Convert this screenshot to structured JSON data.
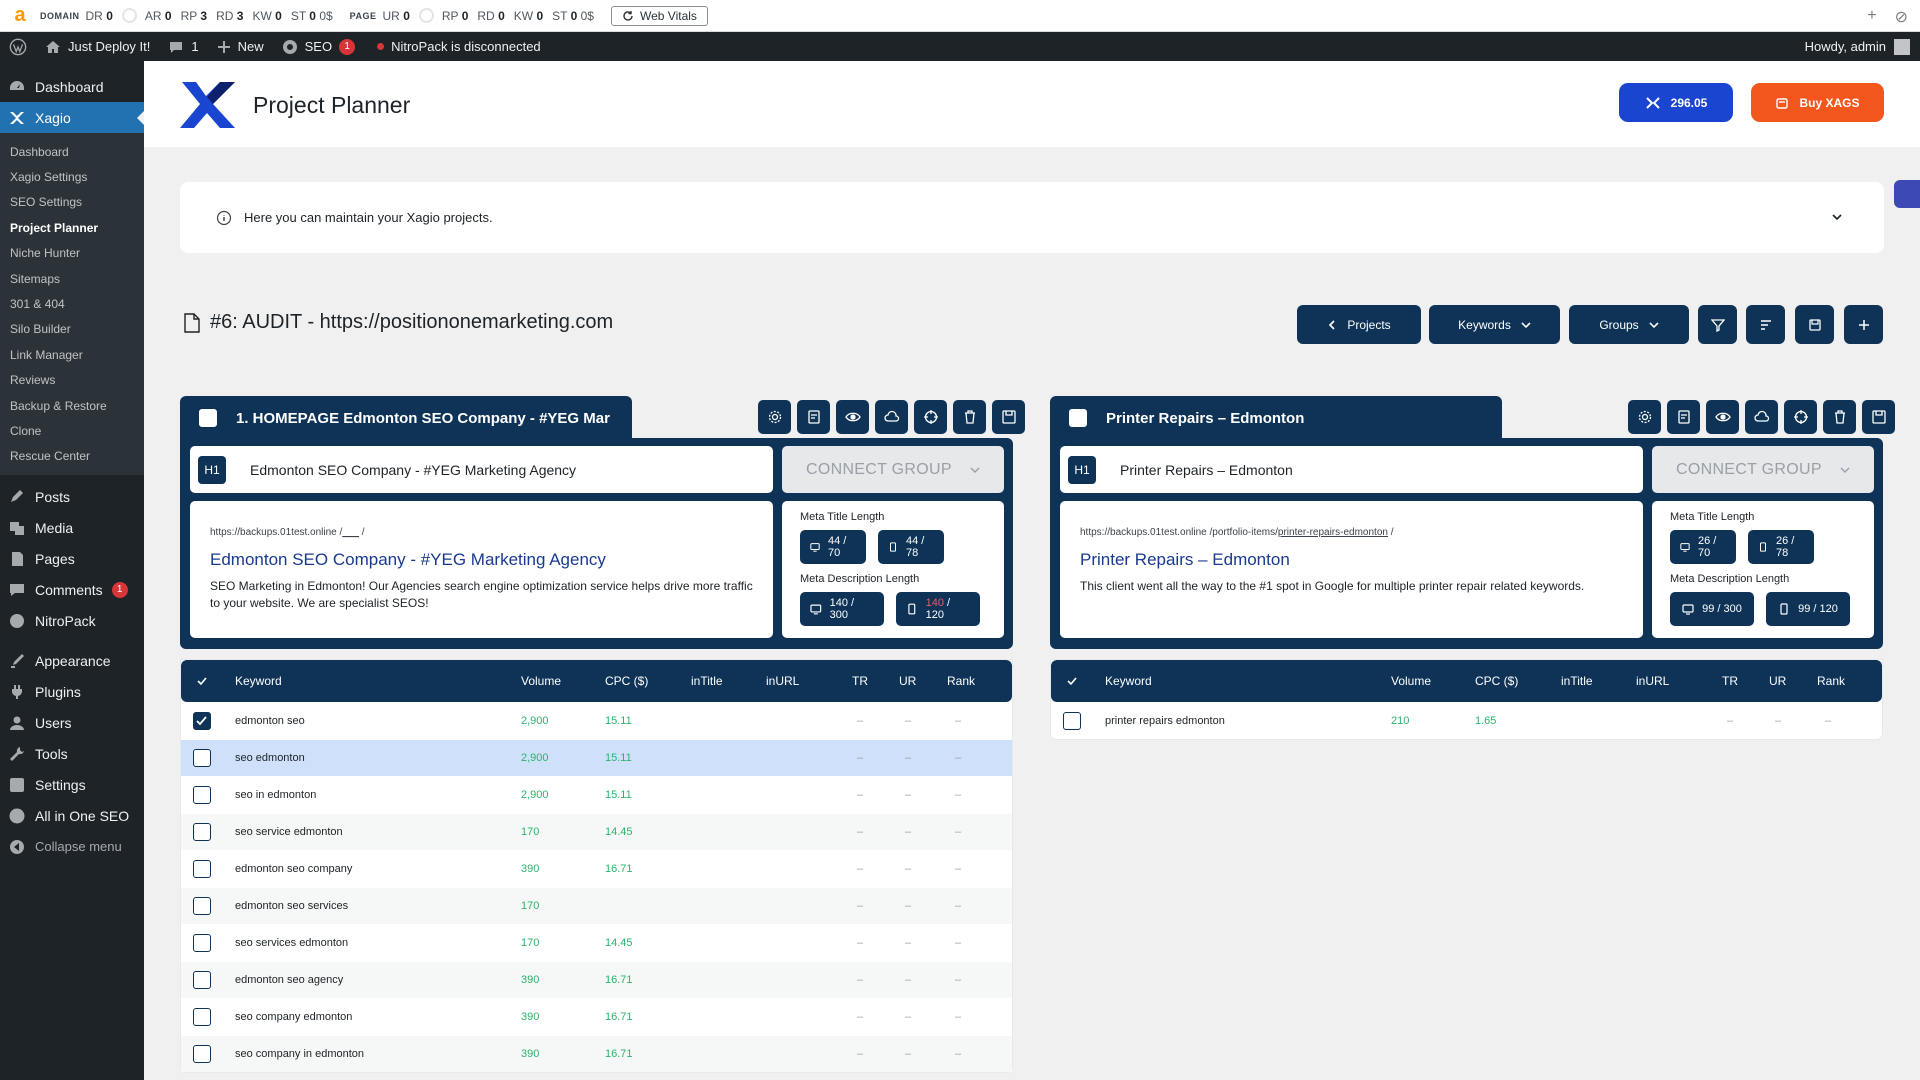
{
  "seobar": {
    "domain_label": "DOMAIN",
    "domain_metrics": [
      {
        "k": "DR",
        "v": "0",
        "ring": true
      },
      {
        "k": "AR",
        "v": "0"
      },
      {
        "k": "RP",
        "v": "3"
      },
      {
        "k": "RD",
        "v": "3"
      },
      {
        "k": "KW",
        "v": "0"
      },
      {
        "k": "ST",
        "v": "0",
        "suffix": "0$"
      }
    ],
    "page_label": "PAGE",
    "page_metrics": [
      {
        "k": "UR",
        "v": "0",
        "ring": true
      },
      {
        "k": "RP",
        "v": "0"
      },
      {
        "k": "RD",
        "v": "0"
      },
      {
        "k": "KW",
        "v": "0"
      },
      {
        "k": "ST",
        "v": "0",
        "suffix": "0$"
      }
    ],
    "web_vitals": "Web Vitals"
  },
  "adminbar": {
    "site": "Just Deploy It!",
    "comments": "1",
    "new": "New",
    "seo": "SEO",
    "seo_badge": "1",
    "nitro": "NitroPack is disconnected",
    "howdy": "Howdy, admin"
  },
  "sidebar": {
    "dashboard": "Dashboard",
    "xagio": "Xagio",
    "sub": [
      "Dashboard",
      "Xagio Settings",
      "SEO Settings",
      "Project Planner",
      "Niche Hunter",
      "Sitemaps",
      "301 & 404",
      "Silo Builder",
      "Link Manager",
      "Reviews",
      "Backup & Restore",
      "Clone",
      "Rescue Center"
    ],
    "menu": [
      "Posts",
      "Media",
      "Pages",
      "Comments",
      "NitroPack",
      "Appearance",
      "Plugins",
      "Users",
      "Tools",
      "Settings",
      "All in One SEO"
    ],
    "comments_badge": "1",
    "collapse": "Collapse menu"
  },
  "header": {
    "title": "Project Planner",
    "credits": "296.05",
    "buy": "Buy XAGS"
  },
  "info": "Here you can maintain your Xagio projects.",
  "project": {
    "title": "#6: AUDIT - https://positiononemarketing.com",
    "toolbar": {
      "projects": "Projects",
      "keywords": "Keywords",
      "groups": "Groups"
    }
  },
  "groups": [
    {
      "name": "1. HOMEPAGE Edmonton SEO Company - #YEG Mar",
      "h1_tag": "H1",
      "h1": "Edmonton SEO Company - #YEG Marketing Agency",
      "connect": "CONNECT GROUP",
      "url_base": "https://backups.01test.online",
      "url_sep": "/",
      "url_slug": "___",
      "url_end": "/",
      "serp_title": "Edmonton SEO Company - #YEG Marketing Agency",
      "serp_desc": "SEO Marketing in Edmonton! Our Agencies search engine optimization service helps drive more traffic to your website. We are specialist SEOS!",
      "meta_title_label": "Meta Title Length",
      "meta_title_desktop": "44 / 70",
      "meta_title_mobile": "44 / 78",
      "meta_desc_label": "Meta Description Length",
      "meta_desc_desktop": "140 / 300",
      "meta_desc_mobile_a": "140",
      "meta_desc_mobile_b": " / 120",
      "columns": [
        "Keyword",
        "Volume",
        "CPC ($)",
        "inTitle",
        "inURL",
        "TR",
        "UR",
        "Rank"
      ],
      "rows": [
        {
          "kw": "edmonton seo",
          "vol": "2,900",
          "cpc": "15.11",
          "tr": "–",
          "ur": "–",
          "rank": "–",
          "checked": true
        },
        {
          "kw": "seo edmonton",
          "vol": "2,900",
          "cpc": "15.11",
          "tr": "–",
          "ur": "–",
          "rank": "–",
          "selected": true
        },
        {
          "kw": "seo in edmonton",
          "vol": "2,900",
          "cpc": "15.11",
          "tr": "–",
          "ur": "–",
          "rank": "–"
        },
        {
          "kw": "seo service edmonton",
          "vol": "170",
          "cpc": "14.45",
          "tr": "–",
          "ur": "–",
          "rank": "–"
        },
        {
          "kw": "edmonton seo company",
          "vol": "390",
          "cpc": "16.71",
          "tr": "–",
          "ur": "–",
          "rank": "–"
        },
        {
          "kw": "edmonton seo services",
          "vol": "170",
          "cpc": "",
          "tr": "–",
          "ur": "–",
          "rank": "–"
        },
        {
          "kw": "seo services edmonton",
          "vol": "170",
          "cpc": "14.45",
          "tr": "–",
          "ur": "–",
          "rank": "–"
        },
        {
          "kw": "edmonton seo agency",
          "vol": "390",
          "cpc": "16.71",
          "tr": "–",
          "ur": "–",
          "rank": "–"
        },
        {
          "kw": "seo company edmonton",
          "vol": "390",
          "cpc": "16.71",
          "tr": "–",
          "ur": "–",
          "rank": "–"
        },
        {
          "kw": "seo company in edmonton",
          "vol": "390",
          "cpc": "16.71",
          "tr": "–",
          "ur": "–",
          "rank": "–"
        }
      ]
    },
    {
      "name": "Printer Repairs – Edmonton",
      "h1_tag": "H1",
      "h1": "Printer Repairs – Edmonton",
      "connect": "CONNECT GROUP",
      "url_base": "https://backups.01test.online",
      "url_sep": "/portfolio-items/",
      "url_slug": "printer-repairs-edmonton",
      "url_end": "/",
      "serp_title": "Printer Repairs – Edmonton",
      "serp_desc": "This client went all the way to the #1 spot in Google for multiple printer repair related keywords.",
      "meta_title_label": "Meta Title Length",
      "meta_title_desktop": "26 / 70",
      "meta_title_mobile": "26 / 78",
      "meta_desc_label": "Meta Description Length",
      "meta_desc_desktop": "99 / 300",
      "meta_desc_mobile_a": "99",
      "meta_desc_mobile_b": " / 120",
      "columns": [
        "Keyword",
        "Volume",
        "CPC ($)",
        "inTitle",
        "inURL",
        "TR",
        "UR",
        "Rank"
      ],
      "rows": [
        {
          "kw": "printer repairs edmonton",
          "vol": "210",
          "cpc": "1.65",
          "tr": "–",
          "ur": "–",
          "rank": "–"
        }
      ]
    }
  ],
  "colors": {
    "navy": "#0e3357",
    "wp_blue": "#2271b1",
    "green": "#2cb36b",
    "orange": "#f3571d",
    "blue": "#1a45d0"
  }
}
